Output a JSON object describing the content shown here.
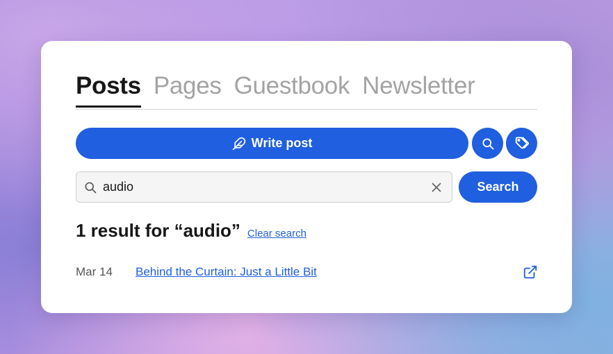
{
  "tabs": [
    {
      "label": "Posts",
      "active": true
    },
    {
      "label": "Pages",
      "active": false
    },
    {
      "label": "Guestbook",
      "active": false
    },
    {
      "label": "Newsletter",
      "active": false
    }
  ],
  "toolbar": {
    "write_label": "Write post",
    "write_icon": "feather-icon",
    "search_icon": "search-icon",
    "tags_icon": "tags-icon"
  },
  "search": {
    "value": "audio",
    "placeholder": "",
    "button_label": "Search",
    "clear_icon": "close-icon"
  },
  "results": {
    "heading": "1 result for “audio”",
    "clear_label": "Clear search",
    "items": [
      {
        "date": "Mar 14",
        "title": "Behind the Curtain: Just a Little Bit",
        "icon": "external-link-icon"
      }
    ]
  },
  "colors": {
    "accent": "#1f5fe0",
    "text": "#171717",
    "muted": "#a3a3a3"
  }
}
